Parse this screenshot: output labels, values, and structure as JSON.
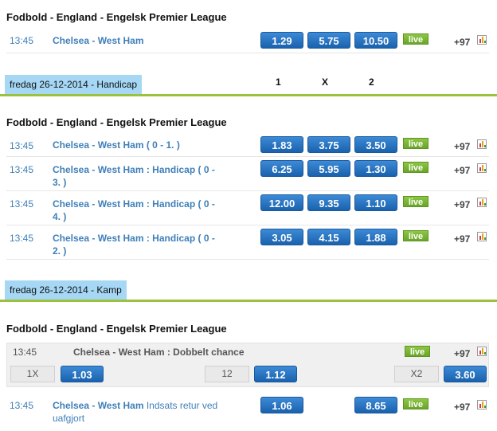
{
  "block1": {
    "league": "Fodbold - England - Engelsk Premier League",
    "rows": [
      {
        "time": "13:45",
        "match": "Chelsea - West Ham",
        "odds": [
          "1.29",
          "5.75",
          "10.50"
        ],
        "live": "live",
        "more": "+97"
      }
    ]
  },
  "section_handicap": {
    "tab": "fredag 26-12-2014 - Handicap",
    "columns": [
      "1",
      "X",
      "2"
    ]
  },
  "block2": {
    "league": "Fodbold - England - Engelsk Premier League",
    "rows": [
      {
        "time": "13:45",
        "match": "Chelsea - West Ham",
        "extra_line1": " ( 0 - 1. )",
        "line2": "",
        "odds": [
          "1.83",
          "3.75",
          "3.50"
        ],
        "live": "live",
        "more": "+97"
      },
      {
        "time": "13:45",
        "match": "Chelsea - West Ham : Handicap ( 0 -",
        "line2": "3. )",
        "odds": [
          "6.25",
          "5.95",
          "1.30"
        ],
        "live": "live",
        "more": "+97"
      },
      {
        "time": "13:45",
        "match": "Chelsea - West Ham : Handicap ( 0 -",
        "line2": "4. )",
        "odds": [
          "12.00",
          "9.35",
          "1.10"
        ],
        "live": "live",
        "more": "+97"
      },
      {
        "time": "13:45",
        "match": "Chelsea - West Ham : Handicap ( 0 -",
        "line2": "2. )",
        "odds": [
          "3.05",
          "4.15",
          "1.88"
        ],
        "live": "live",
        "more": "+97"
      }
    ]
  },
  "section_kamp": {
    "tab": "fredag 26-12-2014 - Kamp"
  },
  "block3": {
    "league": "Fodbold - England - Engelsk Premier League",
    "double_chance": {
      "time": "13:45",
      "match": "Chelsea - West Ham : Dobbelt chance",
      "live": "live",
      "more": "+97",
      "selections": [
        {
          "label": "1X",
          "odd": "1.03"
        },
        {
          "label": "12",
          "odd": "1.12"
        },
        {
          "label": "X2",
          "odd": "3.60"
        }
      ]
    },
    "refund": {
      "time": "13:45",
      "match": "Chelsea - West Ham",
      "extra": " Indsats retur ved",
      "line2": "uafgjort",
      "odds": [
        "1.06",
        "8.65"
      ],
      "live": "live",
      "more": "+97"
    }
  },
  "colors": {
    "odd_button": "#1f6fbf",
    "live_badge": "#7cb83a",
    "section_tab": "#a6d8f5",
    "section_line": "#9bc23c",
    "link": "#3f7fb8"
  }
}
